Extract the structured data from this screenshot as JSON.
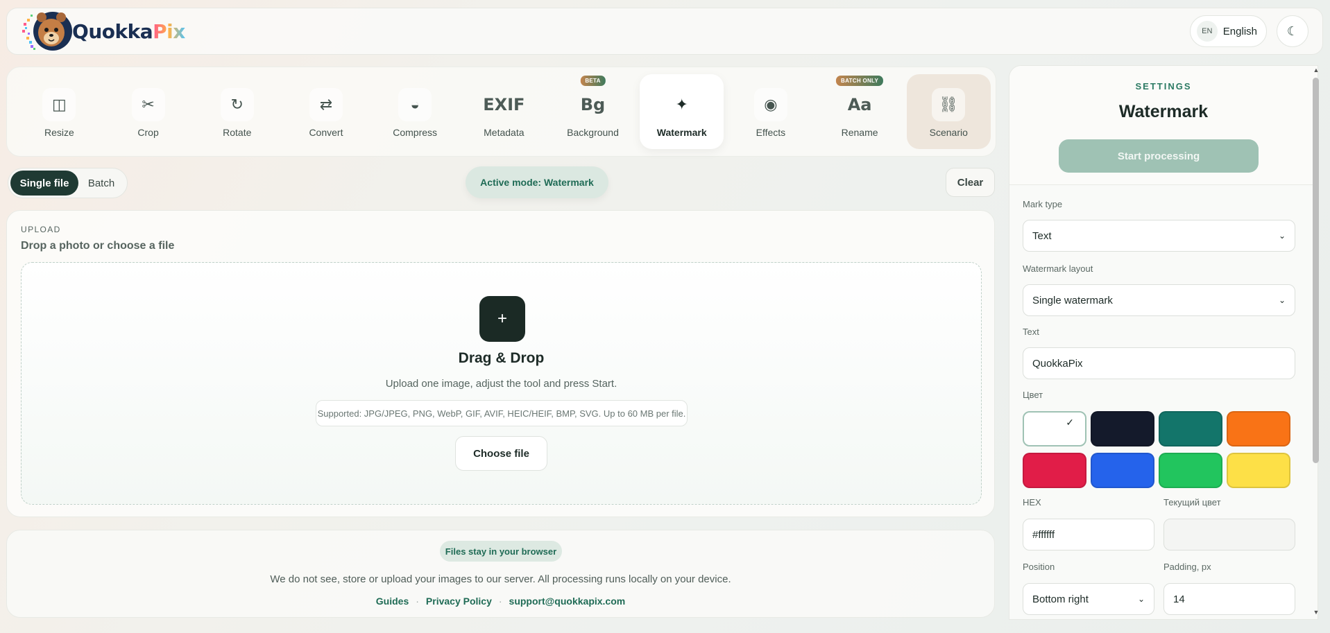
{
  "header": {
    "logo_q": "Q",
    "logo_okka": "uokka",
    "logo_pix": "Pix",
    "lang_code": "EN",
    "lang_label": "English",
    "theme_icon": "☾"
  },
  "tools": [
    {
      "label": "Resize",
      "icon": "◫",
      "icon_name": "resize-icon"
    },
    {
      "label": "Crop",
      "icon": "✂",
      "icon_name": "crop-icon"
    },
    {
      "label": "Rotate",
      "icon": "↻",
      "icon_name": "rotate-icon"
    },
    {
      "label": "Convert",
      "icon": "⇄",
      "icon_name": "convert-icon"
    },
    {
      "label": "Compress",
      "icon": "◒",
      "icon_name": "compress-icon"
    },
    {
      "label": "Metadata",
      "icon": "EXIF",
      "icon_name": "exif-icon"
    },
    {
      "label": "Background",
      "icon": "Bg",
      "icon_name": "background-icon",
      "badge": "BETA"
    },
    {
      "label": "Watermark",
      "icon": "✦",
      "icon_name": "sparkle-icon",
      "active": true
    },
    {
      "label": "Effects",
      "icon": "◉",
      "icon_name": "effects-icon"
    },
    {
      "label": "Rename",
      "icon": "Aa",
      "icon_name": "rename-icon",
      "badge": "BATCH ONLY"
    },
    {
      "label": "Scenario",
      "icon": "⛓",
      "icon_name": "chain-icon"
    }
  ],
  "mode": {
    "single": "Single file",
    "batch": "Batch",
    "active_mode": "Active mode: Watermark",
    "clear": "Clear"
  },
  "upload": {
    "eyebrow": "UPLOAD",
    "title": "Drop a photo or choose a file",
    "plus": "+",
    "dz_title": "Drag & Drop",
    "dz_sub": "Upload one image, adjust the tool and press Start.",
    "supported": "Supported: JPG/JPEG, PNG, WebP, GIF, AVIF, HEIC/HEIF, BMP, SVG. Up to 60 MB per file.",
    "choose": "Choose file"
  },
  "footer": {
    "pill": "Files stay in your browser",
    "text": "We do not see, store or upload your images to our server. All processing runs locally on your device.",
    "links": [
      "Guides",
      "Privacy Policy",
      "support@quokkapix.com"
    ],
    "separator": "·"
  },
  "settings": {
    "eyebrow": "SETTINGS",
    "title": "Watermark",
    "start": "Start processing",
    "mark_type_label": "Mark type",
    "mark_type_value": "Text",
    "layout_label": "Watermark layout",
    "layout_value": "Single watermark",
    "text_label": "Text",
    "text_value": "QuokkaPix",
    "color_label": "Цвет",
    "swatches": [
      "#ffffff",
      "#141a2b",
      "#13756a",
      "#f97316",
      "#e11d48",
      "#2563eb",
      "#22c55e",
      "#fde047"
    ],
    "selected_mark": "✓",
    "hex_label": "HEX",
    "hex_value": "#ffffff",
    "current_color_label": "Текущий цвет",
    "position_label": "Position",
    "position_value": "Bottom right",
    "padding_label": "Padding, px",
    "padding_value": "14"
  }
}
